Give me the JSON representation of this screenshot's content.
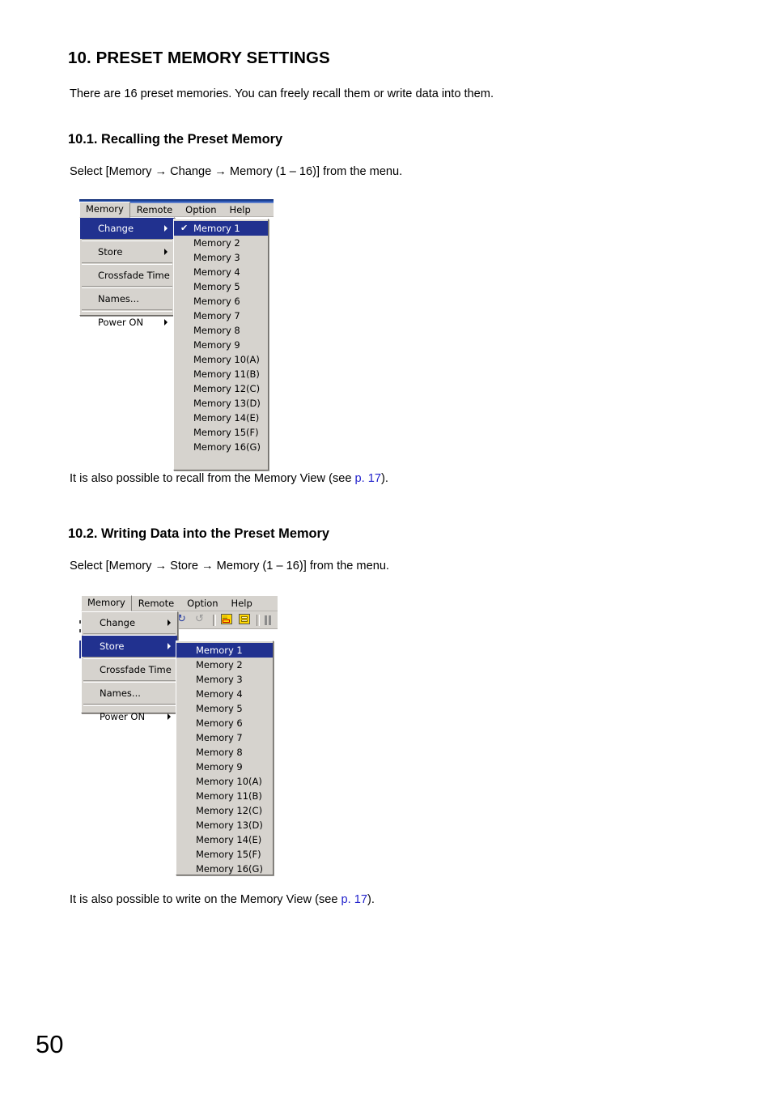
{
  "document": {
    "heading": "10. PRESET MEMORY SETTINGS",
    "intro": "There are 16 preset memories. You can freely recall them or write data into them.",
    "page_number": "50"
  },
  "section_recall": {
    "heading": "10.1. Recalling the Preset Memory",
    "lead_pre": "Select [Memory ",
    "lead_arrow1": "→",
    "lead_mid": " Change ",
    "lead_arrow2": "→",
    "lead_post": " Memory (1 – 16)] from the menu.",
    "note_pre": "It is also possible to recall from the Memory View (see ",
    "note_link": "p. 17",
    "note_post": ")."
  },
  "section_write": {
    "heading": "10.2. Writing Data into the Preset Memory",
    "lead_pre": "Select [Memory ",
    "lead_arrow1": "→",
    "lead_mid": " Store ",
    "lead_arrow2": "→",
    "lead_post": " Memory (1 – 16)] from the menu.",
    "note_pre": "It is also possible to write on the Memory View (see ",
    "note_link": "p. 17",
    "note_post": ")."
  },
  "menubar": {
    "items": [
      {
        "label": "Memory"
      },
      {
        "label": "Remote"
      },
      {
        "label": "Option"
      },
      {
        "label": "Help"
      }
    ]
  },
  "memory_menu": {
    "items": [
      {
        "label": "Change",
        "submenu": true,
        "accel": "C"
      },
      {
        "label": "Store",
        "submenu": true,
        "accel": "S"
      },
      {
        "label": "Crossfade Time",
        "submenu": false,
        "accel": "C"
      },
      {
        "label": "Names...",
        "submenu": false,
        "accel": "N"
      },
      {
        "label": "Power ON",
        "submenu": true,
        "accel": "P"
      }
    ]
  },
  "memory_submenu": {
    "checkmark": "✔",
    "items": [
      "Memory 1",
      "Memory 2",
      "Memory 3",
      "Memory 4",
      "Memory 5",
      "Memory 6",
      "Memory 7",
      "Memory 8",
      "Memory 9",
      "Memory 10(A)",
      "Memory 11(B)",
      "Memory 12(C)",
      "Memory 13(D)",
      "Memory 14(E)",
      "Memory 15(F)",
      "Memory 16(G)"
    ]
  },
  "screenshot_recall": {
    "highlighted_menu_item": "Change",
    "highlighted_submenu_item": "Memory 1",
    "checked_submenu_item": "Memory 1"
  },
  "screenshot_write": {
    "highlighted_menu_item": "Store",
    "highlighted_submenu_item": "Memory 1",
    "toolbar": {
      "undo_icon": "undo-arrow-icon",
      "redo_icon": "redo-arrow-icon",
      "memory_store_icon": "memory-store-icon",
      "memory_recall_icon": "memory-recall-icon",
      "pause_icon": "pause-icon"
    }
  },
  "colors": {
    "menu_face": "#d6d3ce",
    "highlight": "#21318f",
    "link": "#2222cc",
    "titlebar": "#0a246a"
  }
}
